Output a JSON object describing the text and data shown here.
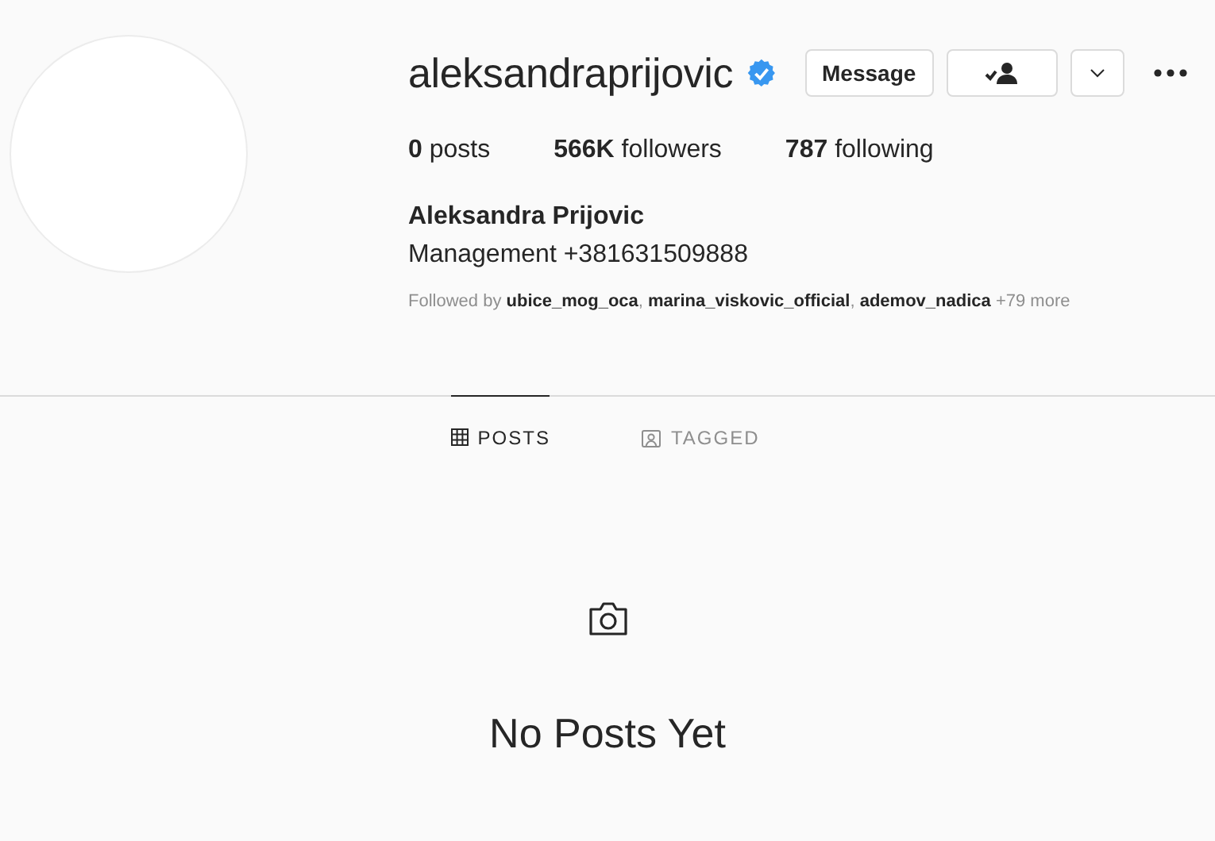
{
  "profile": {
    "username": "aleksandraprijovic",
    "verified": true,
    "buttons": [
      {
        "kind": "text",
        "label": "Message"
      },
      {
        "kind": "following"
      },
      {
        "kind": "dropdown"
      }
    ],
    "stats": [
      {
        "count": "0",
        "label": "posts"
      },
      {
        "count": "566K",
        "label": "followers"
      },
      {
        "count": "787",
        "label": "following"
      }
    ],
    "full_name": "Aleksandra Prijovic",
    "bio": "Management +381631509888",
    "followed_by": "Followed by **ubice_mog_oca**, **marina_viskovic_official**, **ademov_nadica** +79 more"
  },
  "tabs": [
    {
      "kind": "grid",
      "label": "POSTS",
      "selected": true
    },
    {
      "kind": "tagged",
      "label": "TAGGED",
      "selected": false
    }
  ],
  "empty_state": {
    "message": "No Posts Yet"
  }
}
